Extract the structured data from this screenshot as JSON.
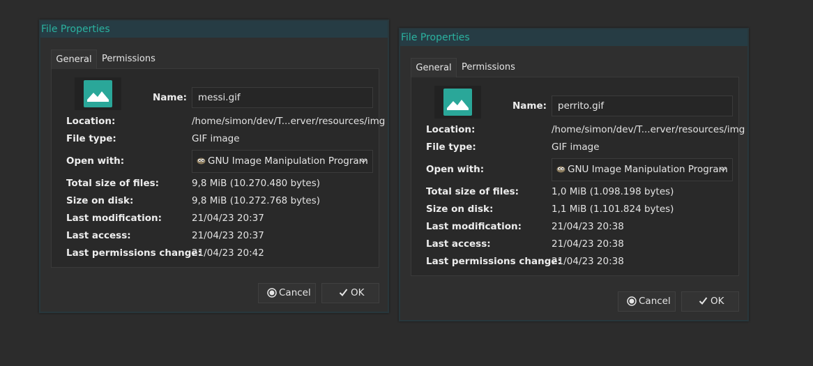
{
  "colors": {
    "background": "#2c2c2c",
    "titlebar": "#263c44",
    "title_text": "#2bb2a0",
    "accent": "#2aa799"
  },
  "labels": {
    "name": "Name:",
    "location": "Location:",
    "file_type": "File type:",
    "open_with": "Open with:",
    "total_size": "Total size of files:",
    "size_on_disk": "Size on disk:",
    "last_modification": "Last modification:",
    "last_access": "Last access:",
    "last_permissions_change": "Last permissions change:"
  },
  "dialogs": [
    {
      "title": "File Properties",
      "tabs": [
        "General",
        "Permissions"
      ],
      "name": "messi.gif",
      "location": "/home/simon/dev/T...erver/resources/img",
      "file_type": "GIF image",
      "open_with": "GNU Image Manipulation Program",
      "total_size": "9,8 MiB (10.270.480 bytes)",
      "size_on_disk": "9,8 MiB (10.272.768 bytes)",
      "last_modification": "21/04/23 20:37",
      "last_access": "21/04/23 20:37",
      "last_permissions_change": "21/04/23 20:42",
      "buttons": {
        "cancel": "Cancel",
        "ok": "OK"
      }
    },
    {
      "title": "File Properties",
      "tabs": [
        "General",
        "Permissions"
      ],
      "name": "perrito.gif",
      "location": "/home/simon/dev/T...erver/resources/img",
      "file_type": "GIF image",
      "open_with": "GNU Image Manipulation Program",
      "total_size": "1,0 MiB (1.098.198 bytes)",
      "size_on_disk": "1,1 MiB (1.101.824 bytes)",
      "last_modification": "21/04/23 20:38",
      "last_access": "21/04/23 20:38",
      "last_permissions_change": "21/04/23 20:38",
      "buttons": {
        "cancel": "Cancel",
        "ok": "OK"
      }
    }
  ],
  "icons": {
    "thumbnail": "image-file-icon",
    "open_with": "gimp-icon",
    "dropdown": "chevron-down-icon",
    "cancel": "cancel-icon",
    "ok": "checkmark-icon"
  }
}
